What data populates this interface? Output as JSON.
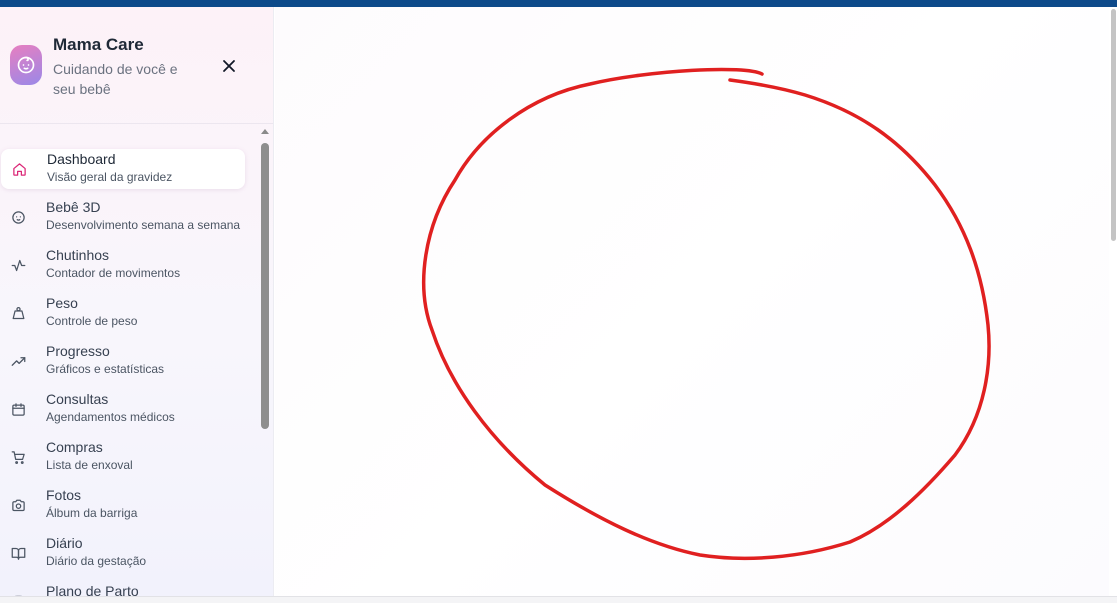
{
  "app": {
    "title": "Mama Care",
    "subtitle": "Cuidando de você e seu bebê"
  },
  "sidebar": {
    "items": [
      {
        "label": "Dashboard",
        "description": "Visão geral da gravidez",
        "icon": "home-icon",
        "active": true
      },
      {
        "label": "Bebê 3D",
        "description": "Desenvolvimento semana a semana",
        "icon": "baby-face-icon",
        "active": false
      },
      {
        "label": "Chutinhos",
        "description": "Contador de movimentos",
        "icon": "activity-icon",
        "active": false
      },
      {
        "label": "Peso",
        "description": "Controle de peso",
        "icon": "weight-icon",
        "active": false
      },
      {
        "label": "Progresso",
        "description": "Gráficos e estatísticas",
        "icon": "trending-up-icon",
        "active": false
      },
      {
        "label": "Consultas",
        "description": "Agendamentos médicos",
        "icon": "calendar-icon",
        "active": false
      },
      {
        "label": "Compras",
        "description": "Lista de enxoval",
        "icon": "cart-icon",
        "active": false
      },
      {
        "label": "Fotos",
        "description": "Álbum da barriga",
        "icon": "camera-icon",
        "active": false
      },
      {
        "label": "Diário",
        "description": "Diário da gestação",
        "icon": "book-icon",
        "active": false
      },
      {
        "label": "Plano de Parto",
        "description": "",
        "icon": "clipboard-icon",
        "active": false
      }
    ]
  },
  "colors": {
    "topbar": "#0d4a8a",
    "accent": "#db2777",
    "annotation": "#e02020"
  }
}
